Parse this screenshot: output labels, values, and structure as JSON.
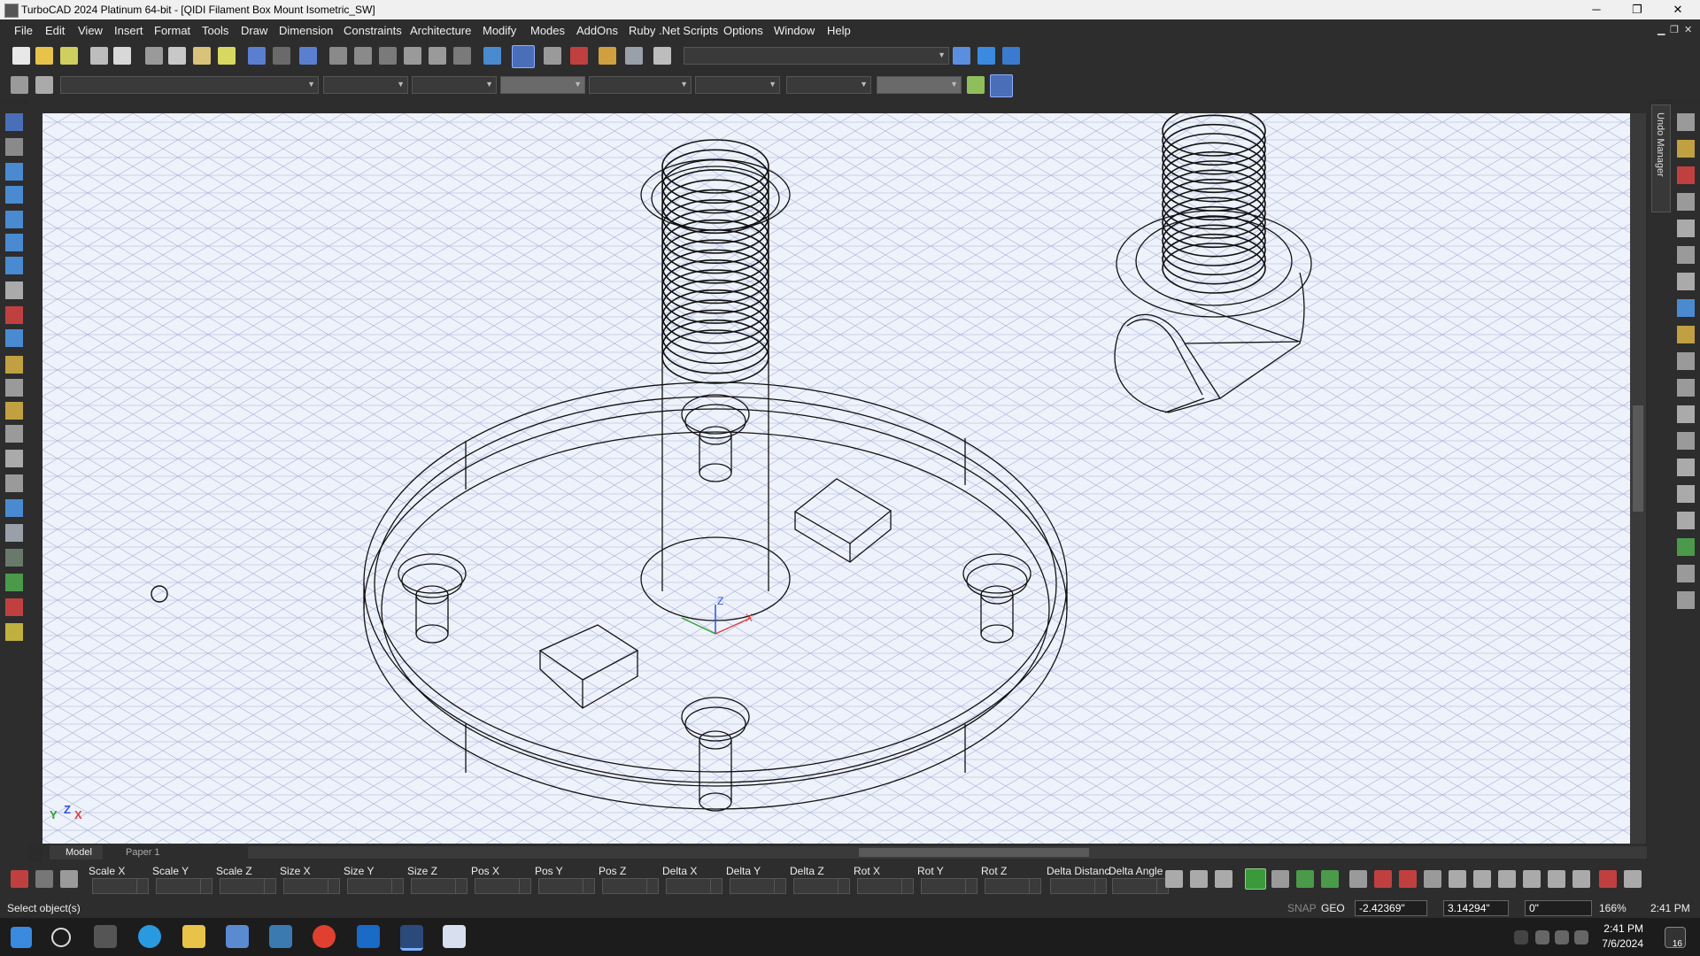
{
  "window": {
    "title": "TurboCAD 2024 Platinum 64-bit - [QIDI Filament Box Mount Isometric_SW]",
    "controls": [
      "─",
      "❐",
      "✕"
    ]
  },
  "menu": [
    "File",
    "Edit",
    "View",
    "Insert",
    "Format",
    "Tools",
    "Draw",
    "Dimension",
    "Constraints",
    "Architecture",
    "Modify",
    "Modes",
    "AddOns",
    "Ruby .Net Scripts",
    "Options",
    "Window",
    "Help"
  ],
  "mdi_controls": [
    "▁",
    "❐",
    "✕"
  ],
  "right_panel": {
    "undo_manager_label": "Undo Manager"
  },
  "tabs": {
    "model": "Model",
    "paper": "Paper 1"
  },
  "inspector_fields": [
    "Scale X",
    "Scale Y",
    "Scale Z",
    "Size X",
    "Size Y",
    "Size Z",
    "Pos X",
    "Pos Y",
    "Pos Z",
    "Delta X",
    "Delta Y",
    "Delta Z",
    "Rot X",
    "Rot Y",
    "Rot Z",
    "Delta Distanc",
    "Delta Angle"
  ],
  "status": {
    "prompt": "Select object(s)",
    "snap": "SNAP",
    "geo": "GEO",
    "x": "-2.42369\"",
    "y": "3.14294\"",
    "angle": "0\"",
    "zoom": "166%",
    "time": "2:41 PM"
  },
  "taskbar": {
    "time": "2:41 PM",
    "date": "7/6/2024",
    "notification_count": "16"
  },
  "ucs_labels": {
    "y": "Y",
    "z": "Z",
    "x": "X"
  },
  "colors": {
    "canvas": "#eef2fb",
    "grid": "#a9b3d8",
    "model_lines": "#111111",
    "chrome": "#2d2d2d"
  }
}
